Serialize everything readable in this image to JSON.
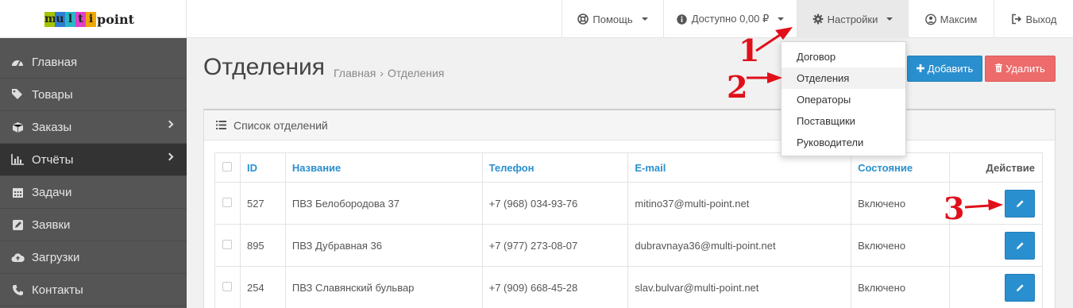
{
  "logo": {
    "letters": [
      "m",
      "u",
      "l",
      "t",
      "i"
    ],
    "letter_colors": [
      "#a5c400",
      "#2d7fd0",
      "#2ab7c8",
      "#e040c8",
      "#f0a800"
    ],
    "rest": "point"
  },
  "navbar": {
    "help": "Помощь",
    "balance": "Доступно 0,00 ₽",
    "settings": "Настройки",
    "user": "Максим",
    "logout": "Выход"
  },
  "sidebar": {
    "items": [
      {
        "label": "Главная",
        "icon": "dashboard-icon"
      },
      {
        "label": "Товары",
        "icon": "tags-icon"
      },
      {
        "label": "Заказы",
        "icon": "cube-icon",
        "has_children": true
      },
      {
        "label": "Отчёты",
        "icon": "bar-chart-icon",
        "has_children": true,
        "active": true
      },
      {
        "label": "Задачи",
        "icon": "calendar-icon"
      },
      {
        "label": "Заявки",
        "icon": "edit-icon"
      },
      {
        "label": "Загрузки",
        "icon": "cloud-upload-icon"
      },
      {
        "label": "Контакты",
        "icon": "phone-icon"
      }
    ]
  },
  "page": {
    "title": "Отделения",
    "breadcrumb_home": "Главная",
    "breadcrumb_sep": "›",
    "breadcrumb_current": "Отделения",
    "add_label": "Добавить",
    "delete_label": "Удалить"
  },
  "panel": {
    "title": "Список отделений"
  },
  "table": {
    "headers": {
      "id": "ID",
      "name": "Название",
      "phone": "Телефон",
      "email": "E-mail",
      "status": "Состояние",
      "action": "Действие"
    },
    "rows": [
      {
        "id": "527",
        "name": "ПВЗ Белобородова 37",
        "phone": "+7 (968) 034-93-76",
        "email": "mitino37@multi-point.net",
        "status": "Включено"
      },
      {
        "id": "895",
        "name": "ПВЗ Дубравная 36",
        "phone": "+7 (977) 273-08-07",
        "email": "dubravnaya36@multi-point.net",
        "status": "Включено"
      },
      {
        "id": "254",
        "name": "ПВЗ Славянский бульвар",
        "phone": "+7 (909) 668-45-28",
        "email": "slav.bulvar@multi-point.net",
        "status": "Включено"
      }
    ]
  },
  "settings_menu": {
    "items": [
      "Договор",
      "Отделения",
      "Операторы",
      "Поставщики",
      "Руководители"
    ],
    "highlighted": "Отделения"
  },
  "annotations": {
    "one": "1",
    "two": "2",
    "three": "3",
    "color": "#e0101a"
  },
  "colors": {
    "primary": "#2a8fcf",
    "danger": "#ed6b6b",
    "sidebar": "#555555",
    "sidebar_active": "#333333"
  }
}
